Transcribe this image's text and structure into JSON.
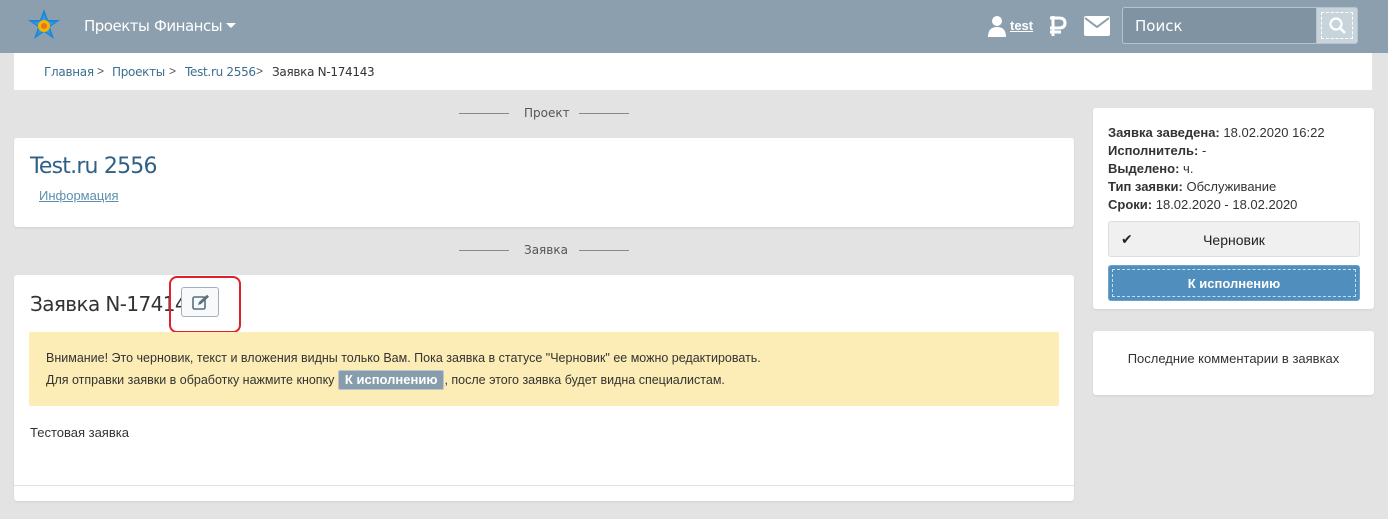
{
  "navbar": {
    "projects": "Проекты",
    "finance": "Финансы",
    "username": "test",
    "search_placeholder": "Поиск"
  },
  "breadcrumb": {
    "items": [
      "Главная",
      "Проекты",
      "Test.ru 2556",
      "Заявка N-174143"
    ],
    "separator": ">"
  },
  "sections": {
    "project": "Проект",
    "order": "Заявка"
  },
  "project": {
    "title": "Test.ru 2556",
    "info_link": "Информация"
  },
  "order": {
    "title": "Заявка N-174143",
    "warning_line1": "Внимание! Это черновик, текст и вложения видны только Вам. Пока заявка в статусе \"Черновик\" ее можно редактировать.",
    "warning_line2_pre": "Для отправки заявки в обработку нажмите кнопку",
    "warning_button": "К исполнению",
    "warning_line2_post": ", после этого заявка будет видна специалистам.",
    "body_text": "Тестовая заявка"
  },
  "details": {
    "created_label": "Заявка заведена:",
    "created_value": "18.02.2020 16:22",
    "executor_label": "Исполнитель:",
    "executor_value": "-",
    "allocated_label": "Выделено:",
    "allocated_value": "ч.",
    "type_label": "Тип заявки:",
    "type_value": "Обслуживание",
    "deadline_label": "Сроки:",
    "deadline_value": "18.02.2020 - 18.02.2020",
    "status": "Черновик",
    "exec_button": "К исполнению"
  },
  "comments": {
    "title": "Последние комментарии в заявках"
  },
  "colors": {
    "navbar": "#8b9fae",
    "link": "#3b6f8f",
    "primary_button": "#4f8ebd",
    "warning_bg": "#fcecb5",
    "highlight": "#e0202a"
  }
}
